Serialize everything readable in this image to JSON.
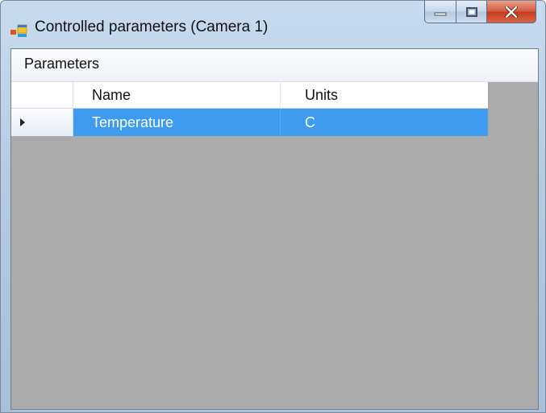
{
  "window": {
    "title": "Controlled parameters (Camera 1)",
    "icon": "app-window-icon",
    "buttons": [
      "minimize-icon",
      "maximize-icon",
      "close-icon"
    ]
  },
  "menu": {
    "items": [
      {
        "label": "Parameters"
      }
    ]
  },
  "grid": {
    "columns": [
      {
        "label": "Name"
      },
      {
        "label": "Units"
      }
    ],
    "rows": [
      {
        "name": "Temperature",
        "units": "C",
        "selected": true
      }
    ]
  },
  "colors": {
    "selection": "#3d9bf0",
    "grid_background": "#ababab",
    "close_button": "#c23a1c"
  }
}
